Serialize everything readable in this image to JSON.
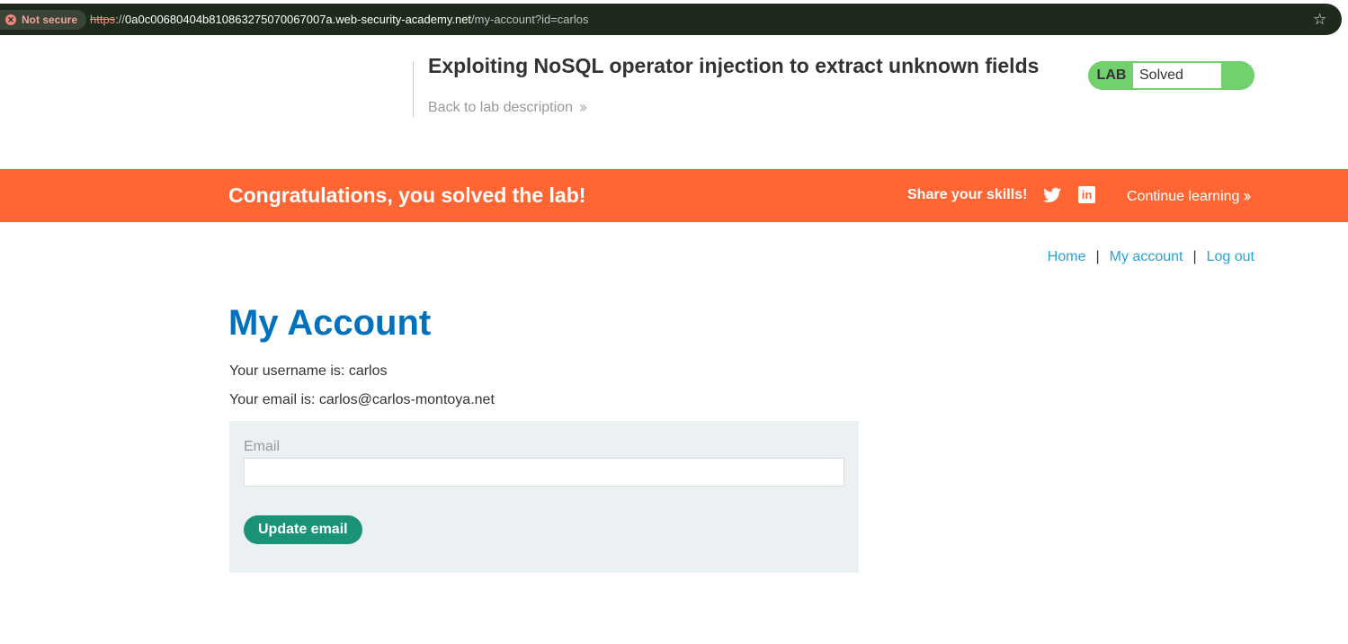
{
  "browser": {
    "security_label": "Not secure",
    "url_scheme": "https",
    "url_sep": "://",
    "url_host": "0a0c00680404b810863275070067007a.web-security-academy.net",
    "url_path": "/my-account?id=carlos",
    "bookmark_icon": "star-icon"
  },
  "lab_header": {
    "title": "Exploiting NoSQL operator injection to extract unknown fields",
    "back_link": "Back to lab description",
    "status_tag": "LAB",
    "status_value": "Solved",
    "status_color": "#70d16d"
  },
  "banner": {
    "message": "Congratulations, you solved the lab!",
    "share_label": "Share your skills!",
    "continue_label": "Continue learning",
    "icons": [
      "twitter-icon",
      "linkedin-icon"
    ],
    "color": "#ff6633"
  },
  "nav": {
    "home": "Home",
    "sep1": "|",
    "my_account": "My account",
    "sep2": "|",
    "log_out": "Log out"
  },
  "account": {
    "title": "My Account",
    "username_line": "Your username is: carlos",
    "email_line": "Your email is: carlos@carlos-montoya.net"
  },
  "email_form": {
    "label": "Email",
    "value": "",
    "placeholder": "",
    "button": "Update email",
    "button_color": "#1a9378"
  }
}
